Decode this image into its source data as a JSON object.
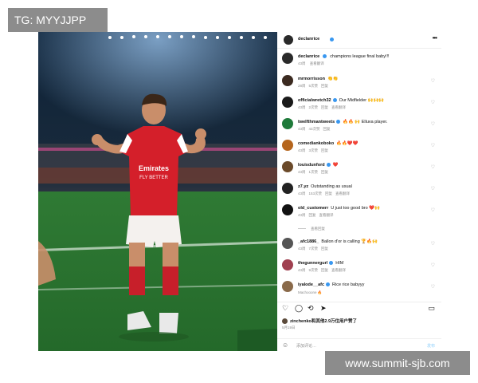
{
  "watermarks": {
    "top_left": "TG: MYYJJPP",
    "bottom_right": "www.summit-sjb.com"
  },
  "photo": {
    "shirt_sponsor": "Emirates FLY BETTER"
  },
  "post": {
    "username": "declanrice",
    "caption": {
      "username": "declanrice",
      "text": "champions league final baby!!!",
      "time": "43周",
      "translate": "查看翻译"
    },
    "comments": [
      {
        "username": "mrmorrisson",
        "text": "👏👏",
        "time": "28周",
        "likes": "5次赞",
        "reply": "回复",
        "avatar_color": "#3b2a20"
      },
      {
        "username": "officialwretch32",
        "text": "Our Midfielder 🙌🙌🙌",
        "time": "43周",
        "likes": "2次赞",
        "reply": "回复",
        "translate": "查看翻译",
        "avatar_color": "#1a1a1a"
      },
      {
        "username": "twelfthmantweets",
        "text": "🔥🔥 🙌 Elluva player.",
        "time": "43周",
        "likes": "43次赞",
        "reply": "回复",
        "avatar_color": "#1f7a3a"
      },
      {
        "username": "comediankoboko",
        "text": "🔥🔥❤️❤️",
        "time": "43周",
        "likes": "3次赞",
        "reply": "回复",
        "avatar_color": "#b5651d"
      },
      {
        "username": "louisdunford",
        "text": "❤️",
        "time": "43周",
        "likes": "1次赞",
        "reply": "回复",
        "avatar_color": "#6b4a2a"
      },
      {
        "username": "z7.yz",
        "text": "Outstanding as usual",
        "time": "43周",
        "likes": "153次赞",
        "reply": "回复",
        "translate": "查看翻译",
        "avatar_color": "#222222"
      },
      {
        "username": "old_customerr",
        "text": "U just too good bro ❤️🙌",
        "time": "43周",
        "likes": "",
        "reply": "回复",
        "translate": "查看翻译",
        "avatar_color": "#111111"
      },
      {
        "username": "_afc1886_",
        "text": "Ballon d'or is calling 🏆🔥🙌",
        "time": "43周",
        "likes": "7次赞",
        "reply": "回复",
        "avatar_color": "#555555"
      },
      {
        "username": "thegunnergurl",
        "text": "HIM",
        "time": "43周",
        "likes": "9次赞",
        "reply": "回复",
        "translate": "查看翻译",
        "avatar_color": "#a04050"
      },
      {
        "username": "iyalode__afc",
        "text": "Rice rice babyyy",
        "time": "",
        "likes": "",
        "reply": "",
        "avatar_color": "#8a6a4a"
      }
    ],
    "view_replies": "查看回复",
    "partial_comment": "Machooone 🔥",
    "likes_line": "zinchenko和其他2.9万位用户赞了",
    "date": "5月19日",
    "add_comment_placeholder": "添加评论…",
    "post_label": "发布"
  },
  "icons": {
    "like": "heart-icon",
    "comment": "comment-icon",
    "share": "share-icon",
    "send": "send-icon",
    "save": "bookmark-icon",
    "more": "more-icon",
    "emoji": "emoji-icon"
  }
}
